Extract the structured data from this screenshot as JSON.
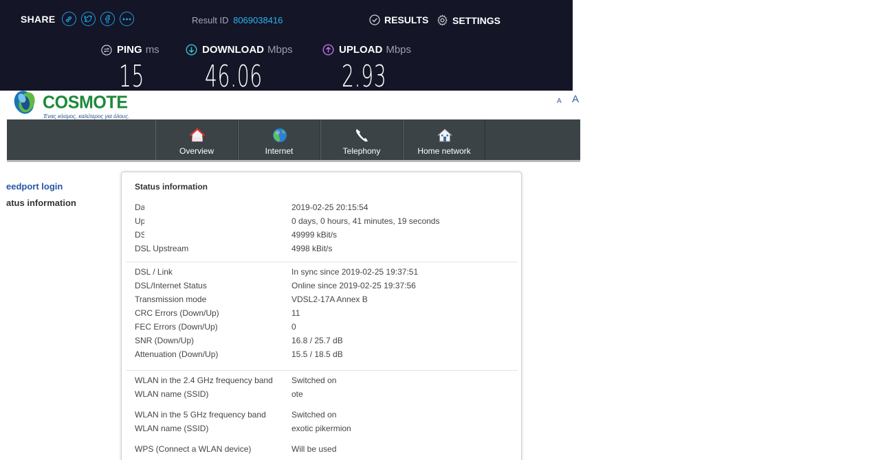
{
  "speedtest": {
    "share_label": "SHARE",
    "share_icons": [
      "link-icon",
      "twitter-icon",
      "facebook-icon",
      "more-icon"
    ],
    "result_label": "Result ID",
    "result_id": "8069038416",
    "results_label": "RESULTS",
    "settings_label": "SETTINGS",
    "ping": {
      "label": "PING",
      "unit": "ms",
      "value": "15"
    },
    "download": {
      "label": "DOWNLOAD",
      "unit": "Mbps",
      "value": "46.06"
    },
    "upload": {
      "label": "UPLOAD",
      "unit": "Mbps",
      "value": "2.93"
    },
    "colors": {
      "background": "#141526",
      "accent": "#1ea0e4",
      "download": "#37c6d6",
      "upload": "#c274e8"
    }
  },
  "router": {
    "brand": "COSMOTE",
    "slogan": "Ένας κόσμος, καλύτερος για όλους.",
    "font_small": "A",
    "font_large": "A",
    "nav": [
      {
        "label": "Overview",
        "icon": "house-icon"
      },
      {
        "label": "Internet",
        "icon": "globe-icon"
      },
      {
        "label": "Telephony",
        "icon": "phone-icon"
      },
      {
        "label": "Home network",
        "icon": "home-network-icon"
      }
    ],
    "sidebar": {
      "login": "eedport login",
      "status": "atus information"
    },
    "panel": {
      "title": "Status information",
      "rows": [
        {
          "key": "Da",
          "value": "2019-02-25 20:15:54"
        },
        {
          "key": "Up",
          "value": "0 days, 0 hours, 41 minutes, 19 seconds"
        },
        {
          "key": "DS",
          "value": "49999 kBit/s"
        },
        {
          "key": "DSL Upstream",
          "value": "4998 kBit/s"
        },
        {
          "key": "DSL / Link",
          "value": "In sync since 2019-02-25 19:37:51"
        },
        {
          "key": "DSL/Internet Status",
          "value": "Online since 2019-02-25 19:37:56"
        },
        {
          "key": "Transmission mode",
          "value": "VDSL2-17A Annex B"
        },
        {
          "key": "CRC Errors (Down/Up)",
          "value": "11"
        },
        {
          "key": "FEC Errors (Down/Up)",
          "value": "0"
        },
        {
          "key": "SNR (Down/Up)",
          "value": "16.8 / 25.7 dB"
        },
        {
          "key": "Attenuation (Down/Up)",
          "value": "15.5 / 18.5 dB"
        },
        {
          "key": "WLAN in the 2.4 GHz frequency band",
          "value": "Switched on"
        },
        {
          "key": "WLAN name (SSID)",
          "value": "ote"
        },
        {
          "key": "WLAN in the 5 GHz frequency band",
          "value": "Switched on"
        },
        {
          "key": "WLAN name (SSID)",
          "value": "exotic pikermion"
        },
        {
          "key": "WPS (Connect a WLAN device)",
          "value": "Will be used"
        }
      ]
    }
  }
}
